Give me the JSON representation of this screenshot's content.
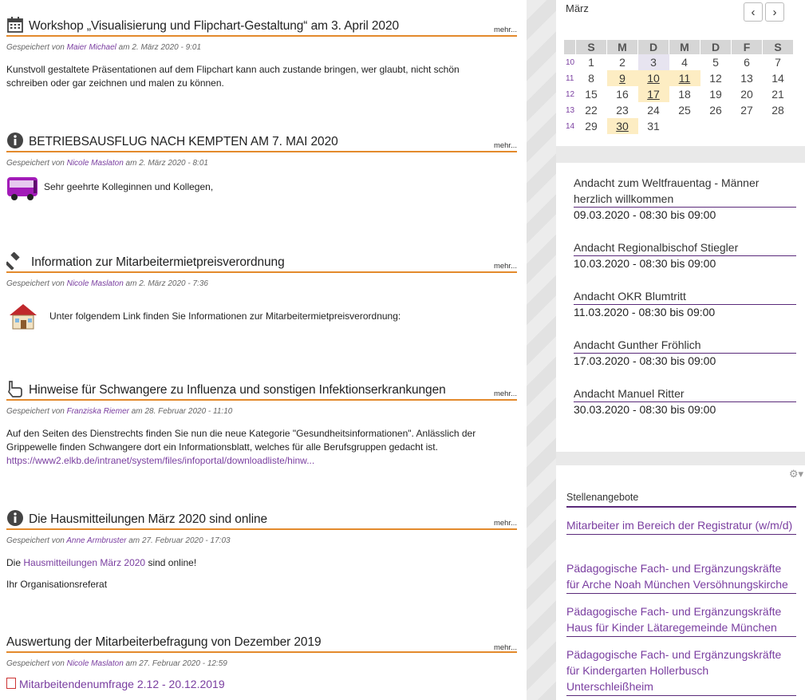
{
  "news": {
    "more_label": "mehr...",
    "saved_by": "Gespeichert von",
    "at": "am",
    "posts": [
      {
        "title": "Workshop „Visualisierung und Flipchart-Gestaltung“ am 3. April 2020",
        "icon": "calendar-icon",
        "author": "Maier Michael",
        "date": "2. März 2020 - 9:01",
        "text": "Kunstvoll gestaltete Präsentationen auf dem Flipchart kann auch zustande bringen, wer glaubt, nicht schön schreiben oder gar zeichnen und malen zu können."
      },
      {
        "title": "BETRIEBSAUSFLUG NACH KEMPTEN AM 7. MAI 2020",
        "icon": "info-icon",
        "author": "Nicole Maslaton",
        "date": "2. März 2020 - 8:01",
        "text": "Sehr geehrte Kolleginnen und Kollegen,"
      },
      {
        "title": "Information zur Mitarbeitermietpreisverordnung",
        "icon": "gavel-icon",
        "author": "Nicole Maslaton",
        "date": "2. März 2020 - 7:36",
        "text": "Unter folgendem Link finden Sie Informationen zur Mitarbeitermietpreisverordnung:"
      },
      {
        "title": "Hinweise für Schwangere zu Influenza und sonstigen Infektionserkrankungen",
        "icon": "pointing-hand-icon",
        "author": "Franziska Riemer",
        "date": "28. Februar 2020 - 11:10",
        "text": "Auf den Seiten des Dienstrechts  finden Sie nun die neue Kategorie \"Gesundheitsinformationen\". Anlässlich der Grippewelle finden Schwangere dort ein Informationsblatt, welches für alle Berufsgruppen gedacht ist.",
        "link": "https://www2.elkb.de/intranet/system/files/infoportal/downloadliste/hinw..."
      },
      {
        "title": "Die Hausmitteilungen März 2020 sind online",
        "icon": "info-icon",
        "author": "Anne Armbruster",
        "date": "27. Februar 2020 - 17:03",
        "text_pre": "Die",
        "text_link": "Hausmitteilungen März 2020",
        "text_post": "sind online!",
        "text2": "Ihr Organisationsreferat"
      },
      {
        "title": "Auswertung der Mitarbeiterbefragung von Dezember 2019",
        "author": "Nicole Maslaton",
        "date": "27. Februar 2020 - 12:59",
        "file": "Mitarbeitendenumfrage 2.12 - 20.12.2019"
      }
    ]
  },
  "calendar": {
    "month": "März",
    "days": [
      "S",
      "M",
      "D",
      "M",
      "D",
      "F",
      "S"
    ],
    "weeks": [
      {
        "wk": "10",
        "d": [
          "1",
          "2",
          "3",
          "4",
          "5",
          "6",
          "7"
        ]
      },
      {
        "wk": "11",
        "d": [
          "8",
          "9",
          "10",
          "11",
          "12",
          "13",
          "14"
        ]
      },
      {
        "wk": "12",
        "d": [
          "15",
          "16",
          "17",
          "18",
          "19",
          "20",
          "21"
        ]
      },
      {
        "wk": "13",
        "d": [
          "22",
          "23",
          "24",
          "25",
          "26",
          "27",
          "28"
        ]
      },
      {
        "wk": "14",
        "d": [
          "29",
          "30",
          "31",
          "",
          "",
          "",
          ""
        ]
      }
    ]
  },
  "events": [
    {
      "title": "Andacht zum Weltfrauentag - Männer herzlich willkommen",
      "time": "09.03.2020 - 08:30 bis 09:00"
    },
    {
      "title": "Andacht Regionalbischof Stiegler",
      "time": "10.03.2020 - 08:30 bis 09:00"
    },
    {
      "title": "Andacht OKR Blumtritt",
      "time": "11.03.2020 - 08:30 bis 09:00"
    },
    {
      "title": "Andacht Gunther Fröhlich",
      "time": "17.03.2020 - 08:30 bis 09:00"
    },
    {
      "title": "Andacht Manuel Ritter",
      "time": "30.03.2020 - 08:30 bis 09:00"
    }
  ],
  "jobs": {
    "heading": "Stellenangebote",
    "items": [
      "Mitarbeiter im Bereich der Registratur (w/m/d)",
      "Pädagogische Fach- und Ergänzungskräfte für Arche Noah München Versöhnungskirche",
      "Pädagogische Fach- und Ergänzungskräfte Haus für Kinder Lätaregemeinde München",
      "Pädagogische Fach- und Ergänzungskräfte für Kindergarten Hollerbusch Unterschleißheim"
    ]
  },
  "colors": {
    "accent_orange": "#e38a2c",
    "accent_purple": "#7a3ea0",
    "event_highlight": "#fdedc3"
  }
}
